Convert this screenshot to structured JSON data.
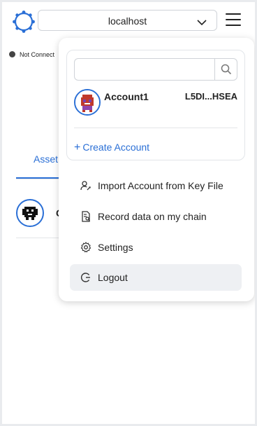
{
  "header": {
    "network": "localhost",
    "status": "Not Connect"
  },
  "main": {
    "tab_assets": "Asset",
    "asset_name": "C"
  },
  "menu": {
    "search": {
      "placeholder": "",
      "value": ""
    },
    "account": {
      "name": "Account1",
      "address": "L5DI...HSEA"
    },
    "create_account": "Create Account",
    "items": [
      {
        "label": "Import Account from Key File",
        "icon": "user-import-icon"
      },
      {
        "label": "Record data on my chain",
        "icon": "document-search-icon"
      },
      {
        "label": "Settings",
        "icon": "gear-icon"
      },
      {
        "label": "Logout",
        "icon": "logout-icon"
      }
    ]
  },
  "colors": {
    "accent": "#2a6fd6",
    "hover_bg": "#eef0f3"
  }
}
